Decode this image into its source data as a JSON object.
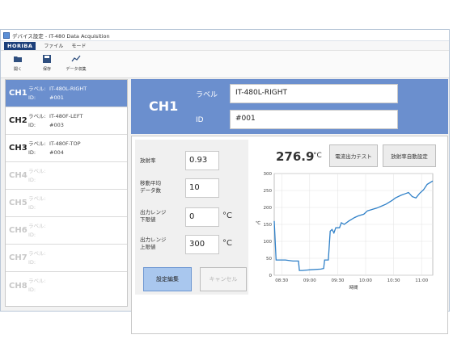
{
  "window": {
    "title": "デバイス設定 - IT-480 Data Acquisition"
  },
  "menu": {
    "logo": "HORIBA",
    "items": [
      "ファイル",
      "モード"
    ]
  },
  "toolbar": {
    "open_label": "開く",
    "save_label": "保存",
    "data_collect_label": "データ収集"
  },
  "channels": [
    {
      "name": "CH1",
      "label_key": "ラベル:",
      "label": "IT-480L-RIGHT",
      "id_key": "ID:",
      "id": "#001",
      "state": "selected"
    },
    {
      "name": "CH2",
      "label_key": "ラベル:",
      "label": "IT-480F-LEFT",
      "id_key": "ID:",
      "id": "#003",
      "state": "normal"
    },
    {
      "name": "CH3",
      "label_key": "ラベル:",
      "label": "IT-480F-TOP",
      "id_key": "ID:",
      "id": "#004",
      "state": "normal"
    },
    {
      "name": "CH4",
      "label_key": "ラベル:",
      "label": "",
      "id_key": "ID:",
      "id": "",
      "state": "disabled"
    },
    {
      "name": "CH5",
      "label_key": "ラベル:",
      "label": "",
      "id_key": "ID:",
      "id": "",
      "state": "disabled"
    },
    {
      "name": "CH6",
      "label_key": "ラベル:",
      "label": "",
      "id_key": "ID:",
      "id": "",
      "state": "disabled"
    },
    {
      "name": "CH7",
      "label_key": "ラベル:",
      "label": "",
      "id_key": "ID:",
      "id": "",
      "state": "disabled"
    },
    {
      "name": "CH8",
      "label_key": "ラベル:",
      "label": "",
      "id_key": "ID:",
      "id": "",
      "state": "disabled"
    }
  ],
  "detail": {
    "channel": "CH1",
    "label_title": "ラベル",
    "label_value": "IT-480L-RIGHT",
    "id_title": "ID",
    "id_value": "#001"
  },
  "params": {
    "emissivity_label": "放射率",
    "emissivity_value": "0.93",
    "moving_avg_label_1": "移動平均",
    "moving_avg_label_2": "データ数",
    "moving_avg_value": "10",
    "out_range_low_label_1": "出力レンジ",
    "out_range_low_label_2": "下限値",
    "out_range_low_value": "0",
    "out_range_high_label_1": "出力レンジ",
    "out_range_high_label_2": "上限値",
    "out_range_high_value": "300",
    "unit": "°C",
    "edit_button": "設定編集",
    "cancel_button": "キャンセル"
  },
  "live": {
    "temperature": "276.9",
    "unit": "°C",
    "current_test_button": "電流出力テスト",
    "auto_emissivity_button": "放射率自動設定"
  },
  "chart_data": {
    "type": "line",
    "xlabel": "時間",
    "ylabel": "℃",
    "x_ticks": [
      "08:30",
      "09:00",
      "09:30",
      "10:00",
      "10:30",
      "11:00"
    ],
    "y_ticks": [
      0,
      50,
      100,
      150,
      200,
      250,
      300
    ],
    "xlim": [
      0,
      170
    ],
    "ylim": [
      0,
      300
    ],
    "grid": true,
    "line_color": "#2f80c8",
    "series": [
      {
        "x": [
          0,
          2,
          4,
          12,
          20,
          26,
          27,
          30,
          38,
          50,
          53,
          54,
          58,
          60,
          62,
          64,
          66,
          70,
          72,
          75,
          80,
          86,
          90,
          96,
          100,
          106,
          110,
          116,
          120,
          126,
          130,
          136,
          140,
          144,
          148,
          152,
          156,
          160,
          164,
          170
        ],
        "y": [
          160,
          45,
          45,
          45,
          42,
          42,
          14,
          14,
          16,
          18,
          20,
          45,
          45,
          130,
          135,
          125,
          140,
          140,
          155,
          150,
          160,
          170,
          175,
          180,
          190,
          195,
          198,
          205,
          210,
          220,
          228,
          236,
          240,
          244,
          232,
          228,
          242,
          252,
          268,
          278
        ]
      }
    ]
  }
}
